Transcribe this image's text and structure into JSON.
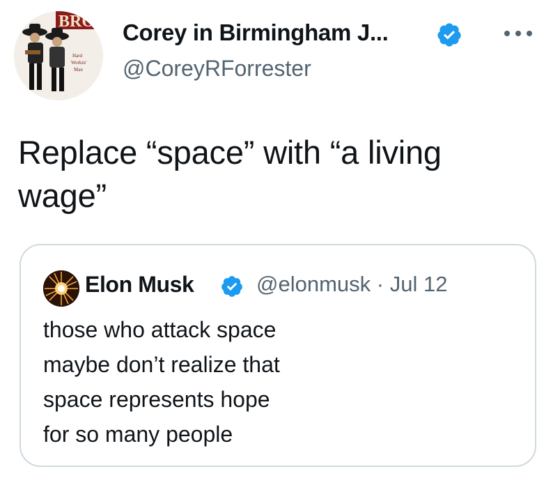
{
  "tweet": {
    "author_name": "Corey in Birmingham J...",
    "author_handle": "@CoreyRForrester",
    "text": "Replace “space” with “a living wage”",
    "avatar_text": "Hard Workin' Man",
    "more_icon": "ellipsis-icon",
    "verified_icon": "verified-badge-icon"
  },
  "quoted_tweet": {
    "author_name": "Elon Musk",
    "author_handle": "@elonmusk",
    "date": "Jul 12",
    "separator": "·",
    "text_lines": [
      "those who attack space",
      "maybe don’t realize that",
      "space represents hope",
      "for so many people"
    ]
  },
  "colors": {
    "verified_blue": "#1d9bf0",
    "secondary_text": "#536471",
    "border": "#cfd9de"
  }
}
